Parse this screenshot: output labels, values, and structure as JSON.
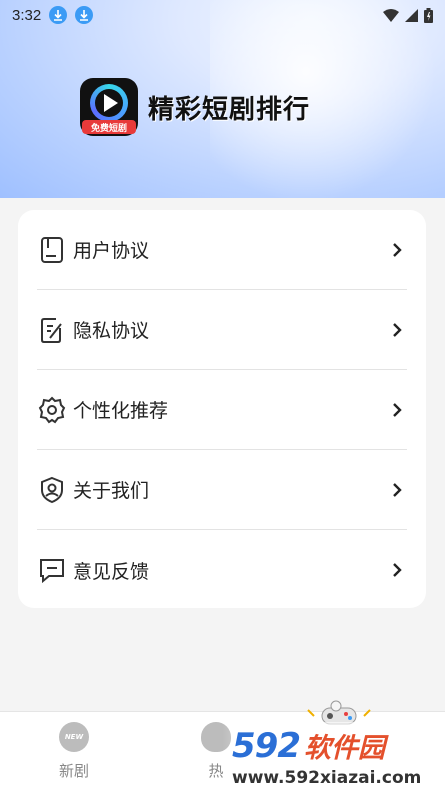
{
  "status_bar": {
    "time": "3:32"
  },
  "app": {
    "name": "精彩短剧排行",
    "logo_tag": "免费短剧"
  },
  "menu": {
    "items": [
      {
        "label": "用户协议",
        "icon": "document-icon"
      },
      {
        "label": "隐私协议",
        "icon": "edit-document-icon"
      },
      {
        "label": "个性化推荐",
        "icon": "gear-icon"
      },
      {
        "label": "关于我们",
        "icon": "shield-user-icon"
      },
      {
        "label": "意见反馈",
        "icon": "message-icon"
      }
    ]
  },
  "bottom_nav": {
    "tabs": [
      {
        "label": "新剧",
        "badge": "NEW"
      },
      {
        "label": "热"
      }
    ]
  },
  "watermark": {
    "num": "592",
    "cn": "软件园",
    "url": "www.592xiazai.com"
  },
  "colors": {
    "accent": "#3b9bf5",
    "logo_tag": "#e83a3a",
    "wm_blue": "#2b6fd6",
    "wm_red": "#e4502c"
  }
}
